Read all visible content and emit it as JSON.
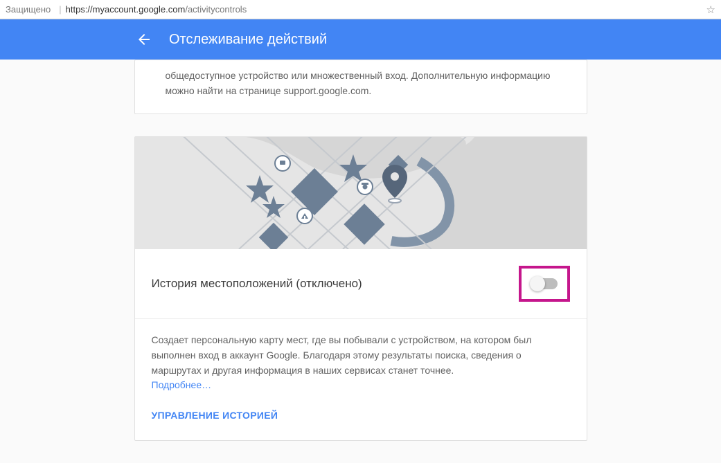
{
  "address_bar": {
    "secure_label": "Защищено",
    "url_host": "https://myaccount.google.com",
    "url_path": "/activitycontrols"
  },
  "header": {
    "title": "Отслеживание действий"
  },
  "top_card": {
    "text_line1": "общедоступное устройство или множественный вход. Дополнительную информацию",
    "text_line2": "можно найти на странице support.google.com."
  },
  "location_card": {
    "title": "История местоположений (отключено)",
    "toggle_on": false,
    "description": "Создает персональную карту мест, где вы побывали с устройством, на котором был выполнен вход в аккаунт Google. Благодаря этому результаты поиска, сведения о маршрутах и другая информация в наших сервисах станет точнее.",
    "learn_more": "Подробнее…",
    "manage_label": "УПРАВЛЕНИЕ ИСТОРИЕЙ"
  },
  "colors": {
    "accent": "#4285f4",
    "highlight_border": "#c5168c"
  }
}
